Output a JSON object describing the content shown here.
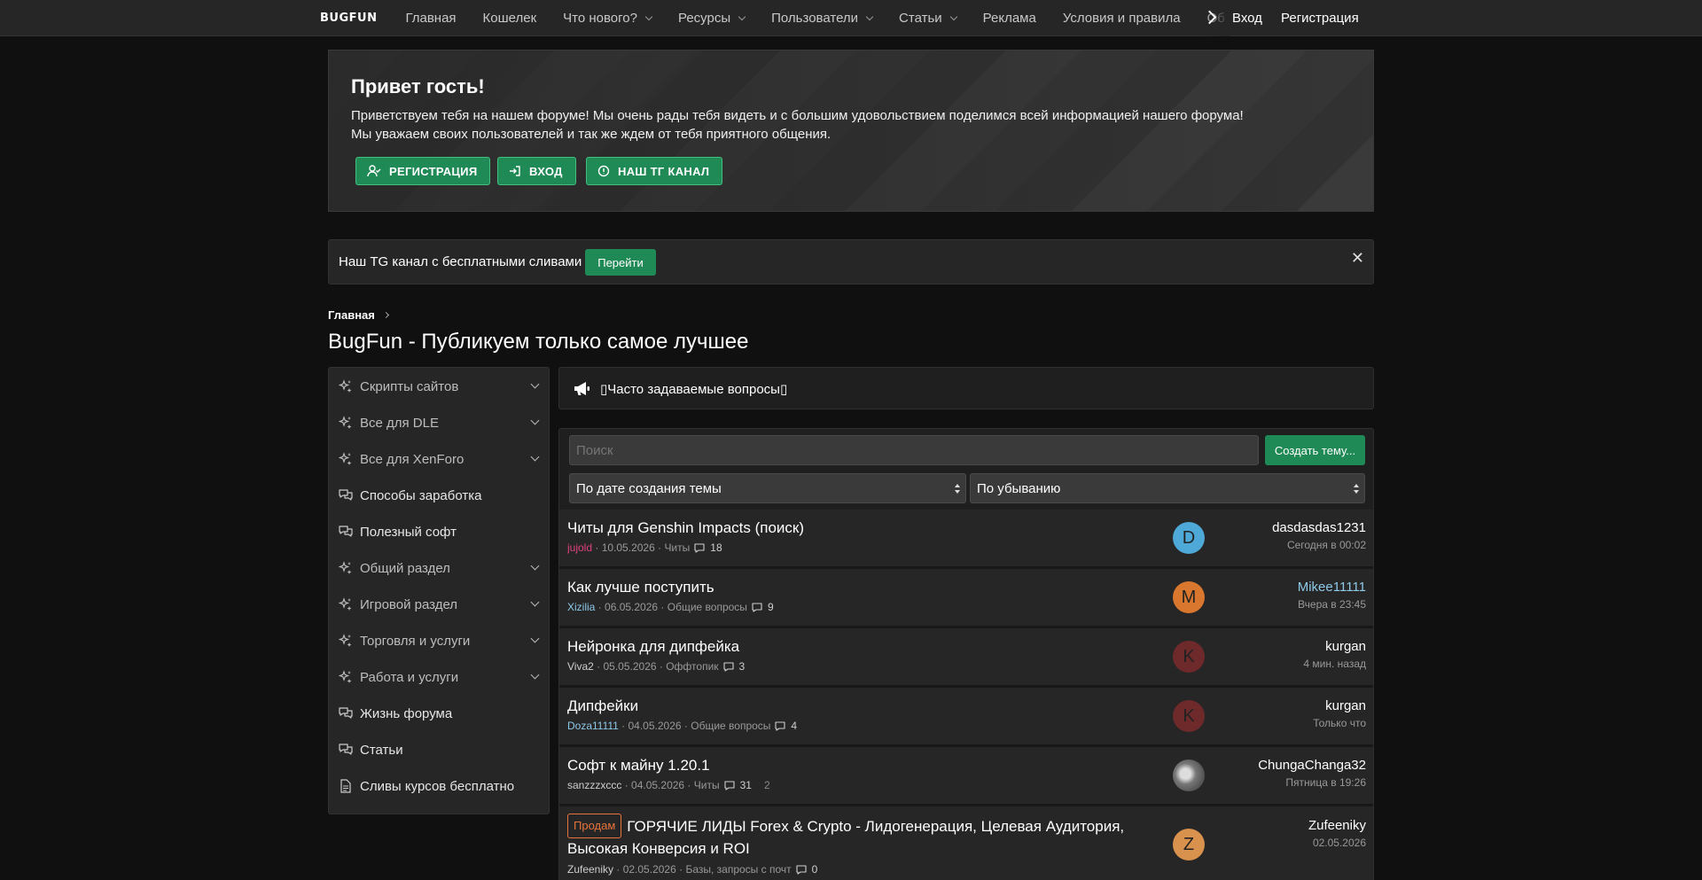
{
  "nav": {
    "logo": "BUGFUN",
    "links": [
      {
        "label": "Главная",
        "dropdown": false
      },
      {
        "label": "Кошелек",
        "dropdown": false
      },
      {
        "label": "Что нового?",
        "dropdown": true
      },
      {
        "label": "Ресурсы",
        "dropdown": true
      },
      {
        "label": "Пользователи",
        "dropdown": true
      },
      {
        "label": "Статьи",
        "dropdown": true
      },
      {
        "label": "Реклама",
        "dropdown": false
      },
      {
        "label": "Условия и правила",
        "dropdown": false
      },
      {
        "label": "Об",
        "dropdown": false
      }
    ],
    "login": "Вход",
    "register": "Регистрация"
  },
  "banner": {
    "title": "Привет гость!",
    "line1": "Приветствуем тебя на нашем форуме! Мы очень рады тебя видеть и с большим удовольствием поделимся всей информацией нашего форума!",
    "line2": "Мы уважаем своих пользователей и так же ждем от тебя приятного общения.",
    "buttons": [
      "РЕГИСТРАЦИЯ",
      "ВХОД",
      "НАШ ТГ КАНАЛ"
    ]
  },
  "notice": {
    "text": "Наш TG канал с бесплатными сливами",
    "button": "Перейти",
    "close": "✕"
  },
  "breadcrumb": "Главная",
  "page_title": "BugFun - Публикуем только самое лучшее",
  "sidebar": {
    "items": [
      {
        "label": "Скрипты сайтов",
        "icon": "sparkle-icon",
        "expandable": true
      },
      {
        "label": "Все для DLE",
        "icon": "sparkle-icon",
        "expandable": true
      },
      {
        "label": "Все для XenForo",
        "icon": "sparkle-icon",
        "expandable": true
      },
      {
        "label": "Способы заработка",
        "icon": "comments-icon",
        "expandable": false
      },
      {
        "label": "Полезный софт",
        "icon": "comments-icon",
        "expandable": false
      },
      {
        "label": "Общий раздел",
        "icon": "sparkle-icon",
        "expandable": true
      },
      {
        "label": "Игровой раздел",
        "icon": "sparkle-icon",
        "expandable": true
      },
      {
        "label": "Торговля и услуги",
        "icon": "sparkle-icon",
        "expandable": true
      },
      {
        "label": "Работа и услуги",
        "icon": "sparkle-icon",
        "expandable": true
      },
      {
        "label": "Жизнь форума",
        "icon": "comments-icon",
        "expandable": false
      },
      {
        "label": "Статьи",
        "icon": "comments-icon",
        "expandable": false
      },
      {
        "label": "Сливы курсов бесплатно",
        "icon": "document-icon",
        "expandable": false
      }
    ]
  },
  "announcement": "Часто задаваемые вопросы",
  "filters": {
    "search_placeholder": "Поиск",
    "create_button": "Создать тему...",
    "sort_by": "По дате создания темы",
    "order": "По убыванию"
  },
  "threads": [
    {
      "title": "Читы для Genshin Impacts (поиск)",
      "prefix": "",
      "author": "jujold",
      "author_color": "#e0407f",
      "date": "10.05.2026",
      "forum": "Читы",
      "replies": "18",
      "extra": "",
      "avatar_letter": "D",
      "avatar_color": "#4fa9d8",
      "last_user": "dasdasdas1231",
      "last_user_color": "#ffffff",
      "last_time": "Сегодня в 00:02"
    },
    {
      "title": "Как лучше поступить",
      "prefix": "",
      "author": "Xizilia",
      "author_color": "#8ec9e8",
      "date": "06.05.2026",
      "forum": "Общие вопросы",
      "replies": "9",
      "extra": "",
      "avatar_letter": "M",
      "avatar_color": "#d9772e",
      "last_user": "Mikee11111",
      "last_user_color": "#8ec9e8",
      "last_time": "Вчера в 23:45"
    },
    {
      "title": "Нейронка для дипфейка",
      "prefix": "",
      "author": "Viva2",
      "author_color": "#cfcfcf",
      "date": "05.05.2026",
      "forum": "Оффтопик",
      "replies": "3",
      "extra": "",
      "avatar_letter": "K",
      "avatar_color": "#6e2a2a",
      "last_user": "kurgan",
      "last_user_color": "#ffffff",
      "last_time": "4 мин. назад"
    },
    {
      "title": "Дипфейки",
      "prefix": "",
      "author": "Doza11111",
      "author_color": "#8ec9e8",
      "date": "04.05.2026",
      "forum": "Общие вопросы",
      "replies": "4",
      "extra": "",
      "avatar_letter": "K",
      "avatar_color": "#6e2a2a",
      "last_user": "kurgan",
      "last_user_color": "#ffffff",
      "last_time": "Только что"
    },
    {
      "title": "Софт к майну 1.20.1",
      "prefix": "",
      "author": "sanzzzxccc",
      "author_color": "#cfcfcf",
      "date": "04.05.2026",
      "forum": "Читы",
      "replies": "31",
      "extra": "2",
      "avatar_letter": "",
      "avatar_color": "#8a8a8a",
      "last_user": "ChungaChanga32",
      "last_user_color": "#ffffff",
      "last_time": "Пятница в 19:26"
    },
    {
      "title": "ГОРЯЧИЕ ЛИДЫ Forex & Crypto - Лидогенерация, Целевая Аудитория, Высокая Конверсия и ROI",
      "prefix": "Продам",
      "author": "Zufeeniky",
      "author_color": "#cfcfcf",
      "date": "02.05.2026",
      "forum": "Базы, запросы с почт",
      "replies": "0",
      "extra": "",
      "avatar_letter": "Z",
      "avatar_color": "#d9924e",
      "last_user": "Zufeeniky",
      "last_user_color": "#ffffff",
      "last_time": "02.05.2026"
    }
  ]
}
